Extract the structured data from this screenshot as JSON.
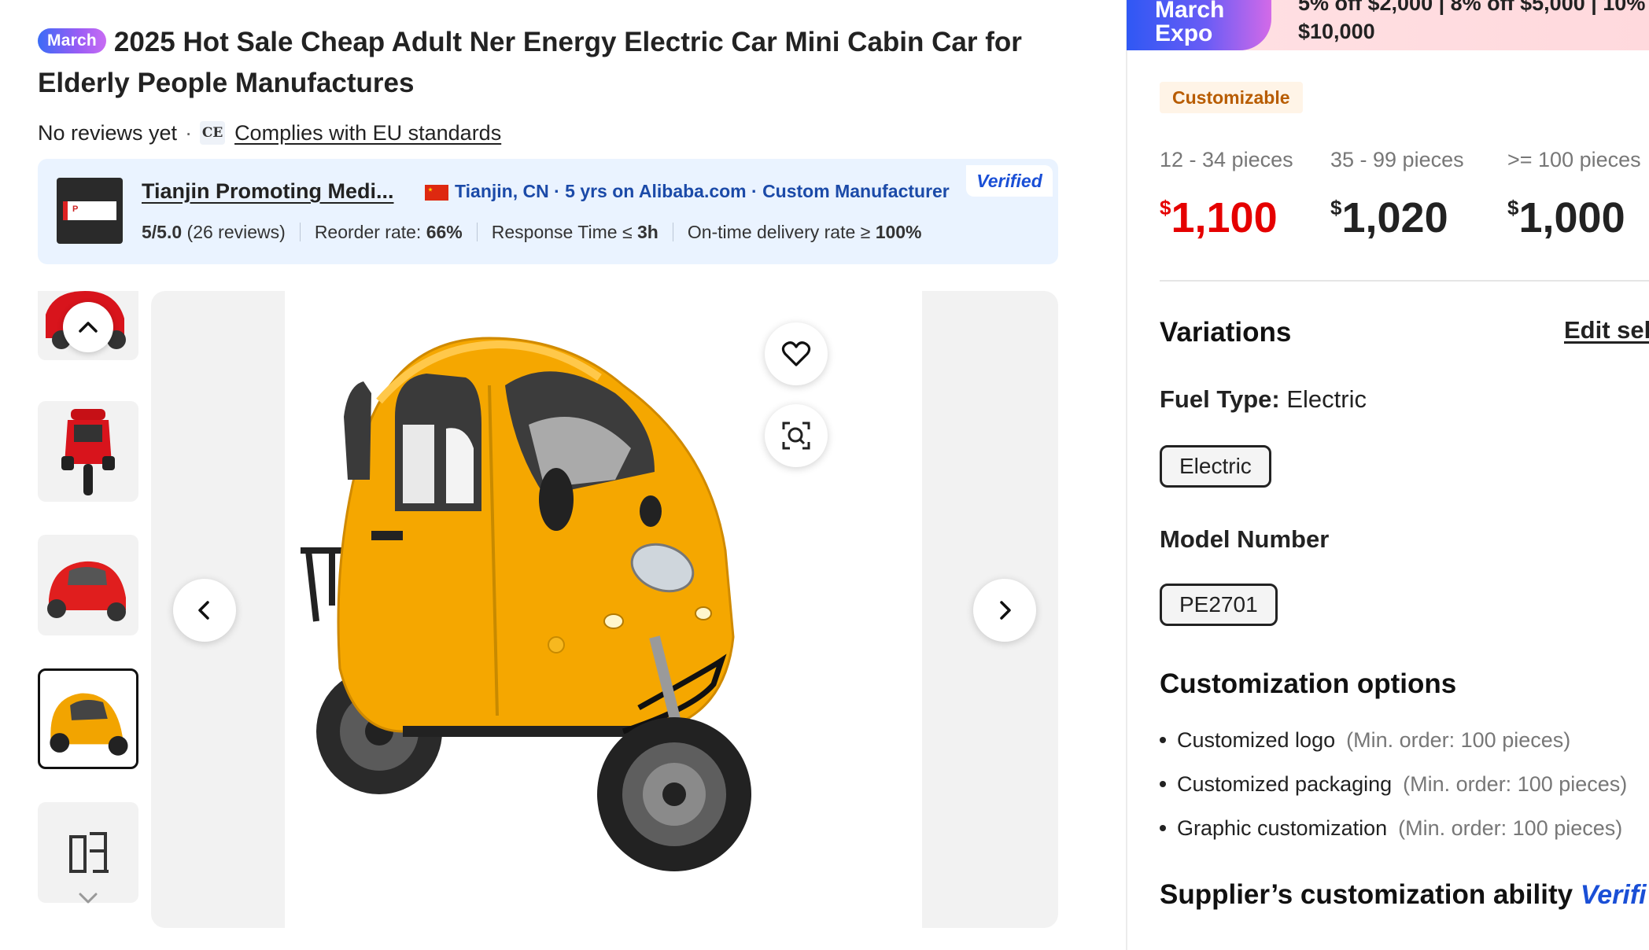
{
  "product": {
    "badge": "March",
    "title": "2025 Hot Sale Cheap Adult Ner Energy Electric Car Mini Cabin Car for Elderly People Manufactures",
    "reviews": "No reviews yet",
    "ce_label": "CE",
    "compliance": "Complies with EU standards"
  },
  "supplier": {
    "name": "Tianjin Promoting Medi...",
    "location": "Tianjin, CN · 5 yrs on Alibaba.com · Custom Manufacturer",
    "verified": "Verified",
    "rating": "5/5.0",
    "rating_reviews": "(26 reviews)",
    "reorder_label": "Reorder rate: ",
    "reorder_value": "66%",
    "response_label": "Response Time ≤ ",
    "response_value": "3h",
    "ontime_label": "On-time delivery rate ≥ ",
    "ontime_value": "100%"
  },
  "gallery": {
    "thumb_colors": [
      "#d8141c",
      "#d8141c",
      "#e01e1e",
      "#f2a400"
    ],
    "accent_main": "#f5a700"
  },
  "expo": {
    "logo_line1": "March",
    "logo_line2": "Expo",
    "discount_line": "5% off $2,000 | 8% off $5,000 | 10%",
    "discount_line2": "$10,000"
  },
  "pricing": {
    "badge": "Customizable",
    "tiers": [
      {
        "range": "12 - 34 pieces",
        "currency": "$",
        "price": "1,100"
      },
      {
        "range": "35 - 99 pieces",
        "currency": "$",
        "price": "1,020"
      },
      {
        "range": ">= 100 pieces",
        "currency": "$",
        "price": "1,000"
      }
    ]
  },
  "variations": {
    "heading": "Variations",
    "edit": "Edit sel",
    "fuel_label": "Fuel Type:",
    "fuel_value": "Electric",
    "fuel_chip": "Electric",
    "model_label": "Model Number",
    "model_chip": "PE2701"
  },
  "customization": {
    "heading": "Customization options",
    "options": [
      {
        "name": "Customized logo",
        "min": "(Min. order: 100 pieces)"
      },
      {
        "name": "Customized packaging",
        "min": "(Min. order: 100 pieces)"
      },
      {
        "name": "Graphic customization",
        "min": "(Min. order: 100 pieces)"
      }
    ],
    "ability_heading": "Supplier’s customization ability",
    "ability_verified": "Verifi"
  }
}
